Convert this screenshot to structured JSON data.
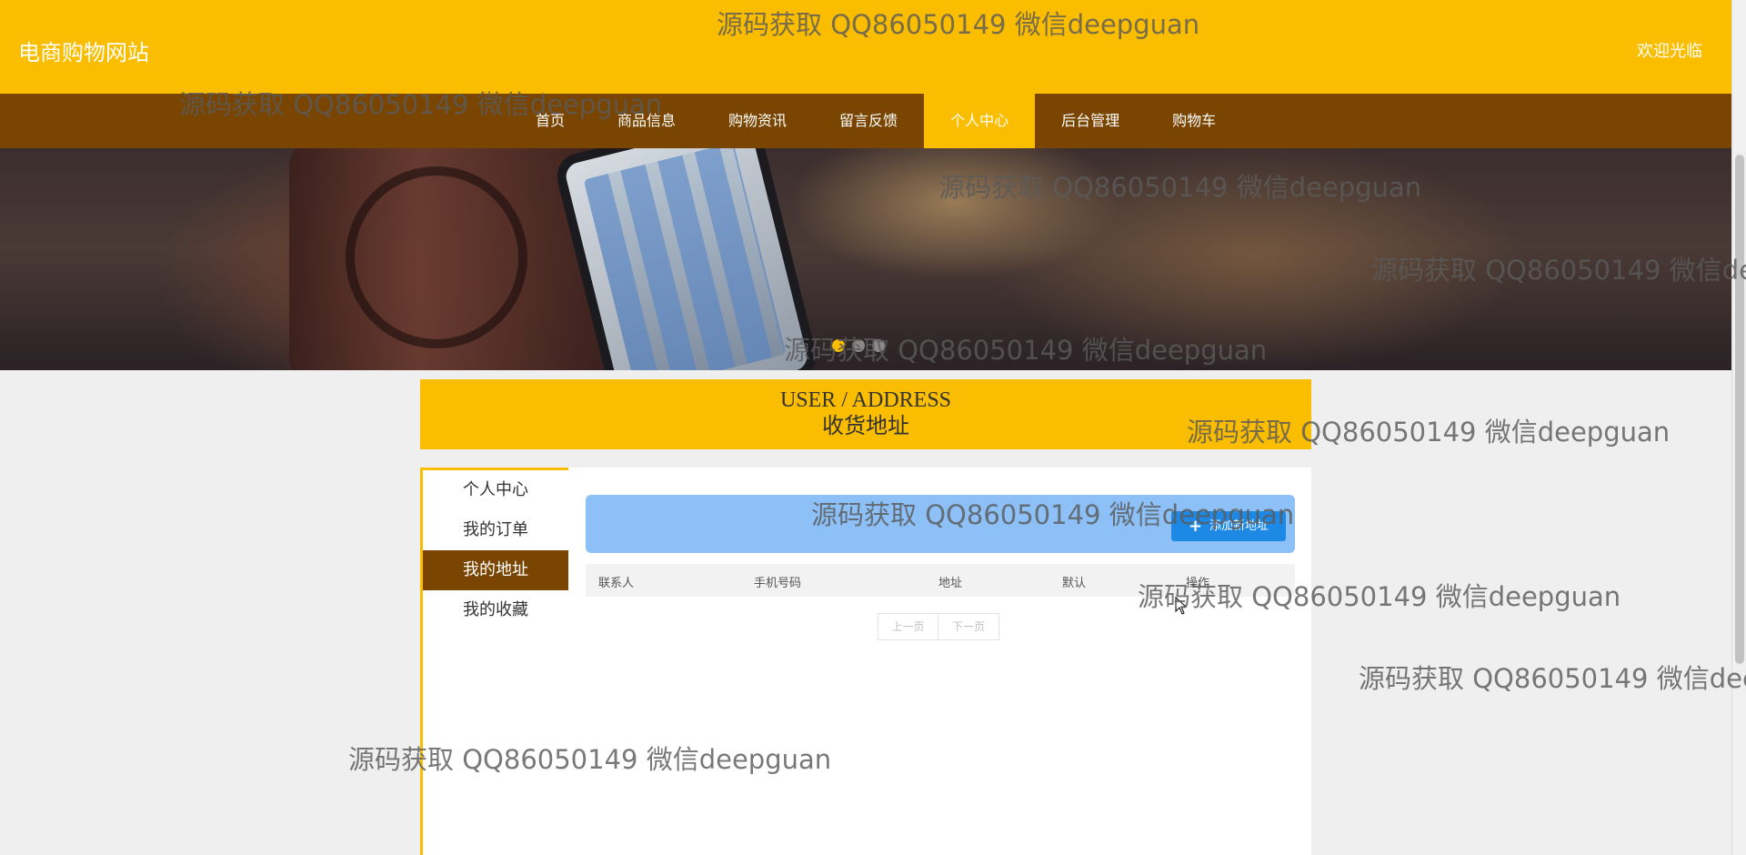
{
  "header": {
    "site_title": "电商购物网站",
    "welcome": "欢迎光临"
  },
  "nav": {
    "items": [
      {
        "label": "首页",
        "active": false
      },
      {
        "label": "商品信息",
        "active": false
      },
      {
        "label": "购物资讯",
        "active": false
      },
      {
        "label": "留言反馈",
        "active": false
      },
      {
        "label": "个人中心",
        "active": true
      },
      {
        "label": "后台管理",
        "active": false
      },
      {
        "label": "购物车",
        "active": false
      }
    ]
  },
  "section": {
    "title_en": "USER / ADDRESS",
    "title_zh": "收货地址"
  },
  "side_menu": {
    "items": [
      {
        "label": "个人中心",
        "active": false
      },
      {
        "label": "我的订单",
        "active": false
      },
      {
        "label": "我的地址",
        "active": true
      },
      {
        "label": "我的收藏",
        "active": false
      }
    ]
  },
  "toolbar": {
    "add_button_label": "添加新地址",
    "add_button_icon": "plus-icon"
  },
  "table": {
    "columns": [
      "联系人",
      "手机号码",
      "地址",
      "默认",
      "操作"
    ],
    "rows": []
  },
  "pager": {
    "prev_label": "上一页",
    "next_label": "下一页"
  },
  "watermark": {
    "text": "源码获取 QQ86050149 微信deepguan"
  },
  "colors": {
    "brand_yellow": "#fbbd00",
    "nav_brown": "#7a4500",
    "toolbar_blue": "#8cc0f6",
    "button_blue": "#1e88e5"
  }
}
